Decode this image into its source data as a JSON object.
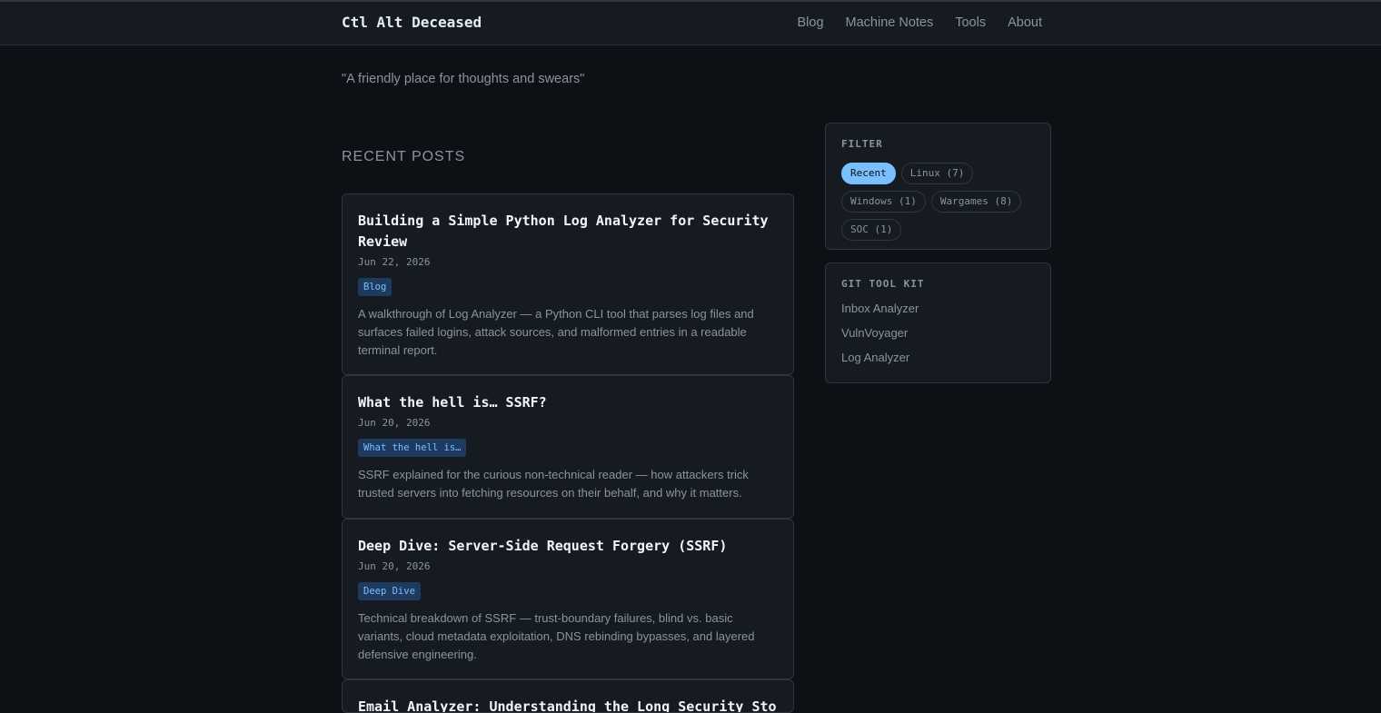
{
  "header": {
    "brand": "Ctl Alt Deceased",
    "nav": [
      "Blog",
      "Machine Notes",
      "Tools",
      "About"
    ]
  },
  "tagline": "\"A friendly place for thoughts and swears\"",
  "recent": {
    "title": "RECENT POSTS",
    "posts": [
      {
        "title": "Building a Simple Python Log Analyzer for Security Review",
        "date": "Jun 22, 2026",
        "tag": "Blog",
        "desc": "A walkthrough of Log Analyzer — a Python CLI tool that parses log files and surfaces failed logins, attack sources, and malformed entries in a readable terminal report."
      },
      {
        "title": "What the hell is… SSRF?",
        "date": "Jun 20, 2026",
        "tag": "What the hell is…",
        "desc": "SSRF explained for the curious non-technical reader — how attackers trick trusted servers into fetching resources on their behalf, and why it matters."
      },
      {
        "title": "Deep Dive: Server-Side Request Forgery (SSRF)",
        "date": "Jun 20, 2026",
        "tag": "Deep Dive",
        "desc": "Technical breakdown of SSRF — trust-boundary failures, blind vs. basic variants, cloud metadata exploitation, DNS rebinding bypasses, and layered defensive engineering."
      },
      {
        "title": "Email Analyzer: Understanding the Long Security Story"
      }
    ]
  },
  "filter": {
    "title": "FILTER",
    "chips": [
      "Recent",
      "Linux (7)",
      "Windows (1)",
      "Wargames (8)",
      "SOC (1)"
    ]
  },
  "tools": {
    "title": "GIT TOOL KIT",
    "items": [
      "Inbox Analyzer",
      "VulnVoyager",
      "Log Analyzer"
    ]
  }
}
